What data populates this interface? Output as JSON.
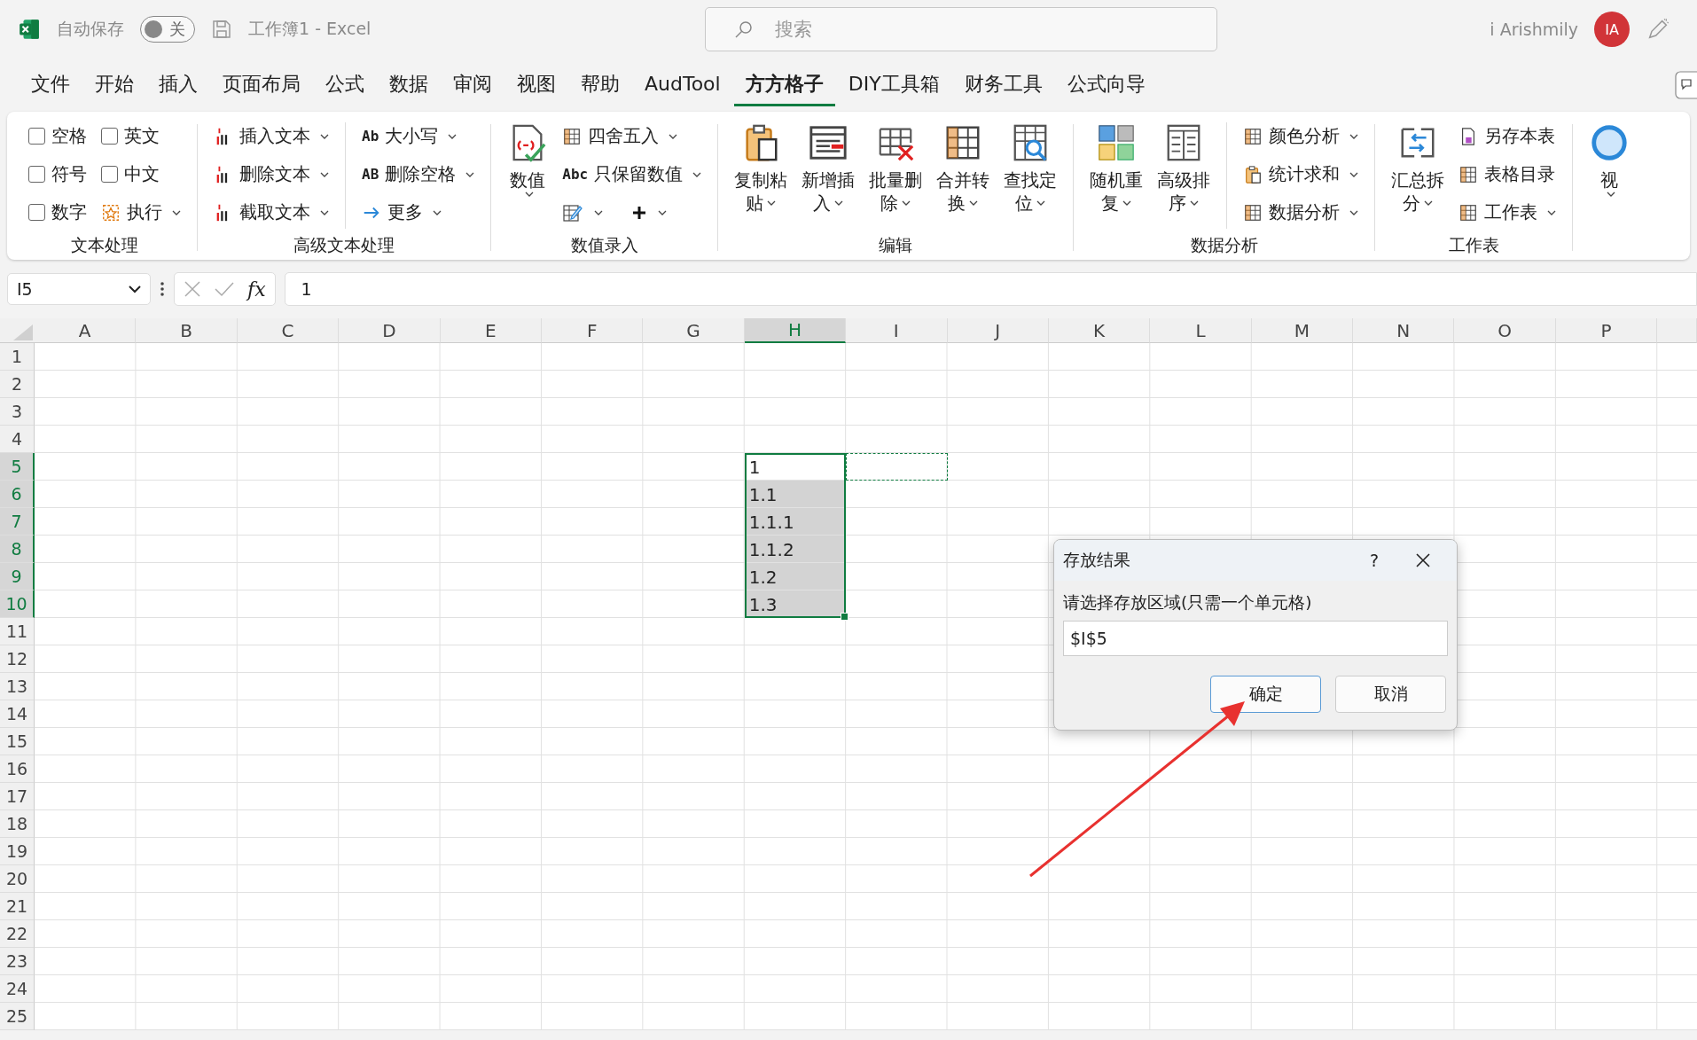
{
  "title_bar": {
    "autosave_label": "自动保存",
    "autosave_toggle": {
      "label": "关",
      "on": false
    },
    "document_title": "工作簿1  -  Excel",
    "search": {
      "placeholder": "搜索"
    },
    "user_name": "i Arishmily",
    "avatar_initials": "IA"
  },
  "menu_tabs": [
    {
      "label": "文件",
      "selected": false
    },
    {
      "label": "开始",
      "selected": false
    },
    {
      "label": "插入",
      "selected": false
    },
    {
      "label": "页面布局",
      "selected": false
    },
    {
      "label": "公式",
      "selected": false
    },
    {
      "label": "数据",
      "selected": false
    },
    {
      "label": "审阅",
      "selected": false
    },
    {
      "label": "视图",
      "selected": false
    },
    {
      "label": "帮助",
      "selected": false
    },
    {
      "label": "AudTool",
      "selected": false
    },
    {
      "label": "方方格子",
      "selected": true
    },
    {
      "label": "DIY工具箱",
      "selected": false
    },
    {
      "label": "财务工具",
      "selected": false
    },
    {
      "label": "公式向导",
      "selected": false
    }
  ],
  "ribbon": [
    {
      "label": "文本处理",
      "columns": [
        {
          "kind": "stack",
          "divider": false,
          "items": [
            {
              "kind": "checkbox",
              "label": "空格",
              "checked": false
            },
            {
              "kind": "checkbox",
              "label": "符号",
              "checked": false
            },
            {
              "kind": "checkbox",
              "label": "数字",
              "checked": false
            }
          ]
        },
        {
          "kind": "stack",
          "divider": false,
          "items": [
            {
              "kind": "checkbox",
              "label": "英文",
              "checked": false
            },
            {
              "kind": "checkbox",
              "label": "中文",
              "checked": false
            },
            {
              "kind": "small",
              "label": "执行",
              "dropdown": true
            }
          ]
        }
      ]
    },
    {
      "label": "高级文本处理",
      "columns": [
        {
          "kind": "stack",
          "divider": false,
          "items": [
            {
              "kind": "small",
              "label": "插入文本",
              "dropdown": true
            },
            {
              "kind": "small",
              "label": "删除文本",
              "dropdown": true
            },
            {
              "kind": "small",
              "label": "截取文本",
              "dropdown": true
            }
          ]
        },
        {
          "kind": "stack",
          "divider": true,
          "items": [
            {
              "kind": "small",
              "icon_text": "Ab",
              "label": "大小写",
              "dropdown": true
            },
            {
              "kind": "small",
              "icon_text": "AB",
              "label": "删除空格",
              "dropdown": true
            },
            {
              "kind": "small",
              "label": "更多",
              "dropdown": true
            }
          ]
        }
      ]
    },
    {
      "label": "数值录入",
      "columns": [
        {
          "kind": "large",
          "divider": false,
          "items": [
            {
              "lines": [
                "数值"
              ],
              "dropdown": true
            }
          ]
        },
        {
          "kind": "stack",
          "divider": false,
          "items": [
            {
              "kind": "small",
              "label": "四舍五入",
              "dropdown": true
            },
            {
              "kind": "small",
              "icon_text": "Abc",
              "label": "只保留数值",
              "dropdown": true
            },
            {
              "kind": "icon_row",
              "buttons": [
                {
                  "dropdown": true
                },
                {
                  "dropdown": true
                }
              ]
            }
          ]
        }
      ]
    },
    {
      "label": "编辑",
      "columns": [
        {
          "kind": "large",
          "divider": false,
          "items": [
            {
              "lines": [
                "复制粘",
                "贴"
              ],
              "dropdown": true
            },
            {
              "lines": [
                "新增插",
                "入"
              ],
              "dropdown": true
            },
            {
              "lines": [
                "批量删",
                "除"
              ],
              "dropdown": true
            },
            {
              "lines": [
                "合并转",
                "换"
              ],
              "dropdown": true
            },
            {
              "lines": [
                "查找定",
                "位"
              ],
              "dropdown": true
            }
          ]
        }
      ]
    },
    {
      "label": "数据分析",
      "columns": [
        {
          "kind": "large",
          "divider": false,
          "items": [
            {
              "lines": [
                "随机重",
                "复"
              ],
              "dropdown": true
            },
            {
              "lines": [
                "高级排",
                "序"
              ],
              "dropdown": true
            }
          ]
        },
        {
          "kind": "stack",
          "divider": true,
          "items": [
            {
              "kind": "small",
              "label": "颜色分析",
              "dropdown": true
            },
            {
              "kind": "small",
              "label": "统计求和",
              "dropdown": true
            },
            {
              "kind": "small",
              "label": "数据分析",
              "dropdown": true
            }
          ]
        }
      ]
    },
    {
      "label": "工作表",
      "columns": [
        {
          "kind": "large",
          "divider": false,
          "items": [
            {
              "lines": [
                "汇总拆",
                "分"
              ],
              "dropdown": true
            }
          ]
        },
        {
          "kind": "stack",
          "divider": false,
          "items": [
            {
              "kind": "small",
              "label": "另存本表",
              "dropdown": false
            },
            {
              "kind": "small",
              "label": "表格目录",
              "dropdown": false
            },
            {
              "kind": "small",
              "label": "工作表",
              "dropdown": true
            }
          ]
        }
      ]
    },
    {
      "columns": [
        {
          "kind": "large",
          "divider": false,
          "items": [
            {
              "lines": [
                "视"
              ],
              "dropdown": true
            }
          ]
        }
      ]
    }
  ],
  "formula_bar": {
    "name_box": "I5",
    "function_button": "fx",
    "value": "1"
  },
  "sheet": {
    "columns": [
      {
        "label": "A",
        "selected": false
      },
      {
        "label": "B",
        "selected": false
      },
      {
        "label": "C",
        "selected": false
      },
      {
        "label": "D",
        "selected": false
      },
      {
        "label": "E",
        "selected": false
      },
      {
        "label": "F",
        "selected": false
      },
      {
        "label": "G",
        "selected": false
      },
      {
        "label": "H",
        "selected": true
      },
      {
        "label": "I",
        "selected": false
      },
      {
        "label": "J",
        "selected": false
      },
      {
        "label": "K",
        "selected": false
      },
      {
        "label": "L",
        "selected": false
      },
      {
        "label": "M",
        "selected": false
      },
      {
        "label": "N",
        "selected": false
      },
      {
        "label": "O",
        "selected": false
      },
      {
        "label": "P",
        "selected": false
      }
    ],
    "rows": [
      {
        "label": "1",
        "selected": false
      },
      {
        "label": "2",
        "selected": false
      },
      {
        "label": "3",
        "selected": false
      },
      {
        "label": "4",
        "selected": false
      },
      {
        "label": "5",
        "selected": true
      },
      {
        "label": "6",
        "selected": true
      },
      {
        "label": "7",
        "selected": true
      },
      {
        "label": "8",
        "selected": true
      },
      {
        "label": "9",
        "selected": true
      },
      {
        "label": "10",
        "selected": true
      },
      {
        "label": "11",
        "selected": false
      },
      {
        "label": "12",
        "selected": false
      },
      {
        "label": "13",
        "selected": false
      },
      {
        "label": "14",
        "selected": false
      },
      {
        "label": "15",
        "selected": false
      },
      {
        "label": "16",
        "selected": false
      },
      {
        "label": "17",
        "selected": false
      },
      {
        "label": "18",
        "selected": false
      },
      {
        "label": "19",
        "selected": false
      },
      {
        "label": "20",
        "selected": false
      },
      {
        "label": "21",
        "selected": false
      },
      {
        "label": "22",
        "selected": false
      },
      {
        "label": "23",
        "selected": false
      },
      {
        "label": "24",
        "selected": false
      },
      {
        "label": "25",
        "selected": false
      }
    ],
    "selection_values": [
      {
        "value": "1",
        "active": true
      },
      {
        "value": "1.1",
        "active": false
      },
      {
        "value": "1.1.1",
        "active": false
      },
      {
        "value": "1.1.2",
        "active": false
      },
      {
        "value": "1.2",
        "active": false
      },
      {
        "value": "1.3",
        "active": false
      }
    ],
    "copy_marquee": true
  },
  "dialog": {
    "title": "存放结果",
    "help": "?",
    "prompt": "请选择存放区域(只需一个单元格)",
    "input_value": "$I$5",
    "buttons": [
      {
        "label": "确定",
        "default": true
      },
      {
        "label": "取消",
        "default": false
      }
    ]
  },
  "annotation_arrow": true
}
